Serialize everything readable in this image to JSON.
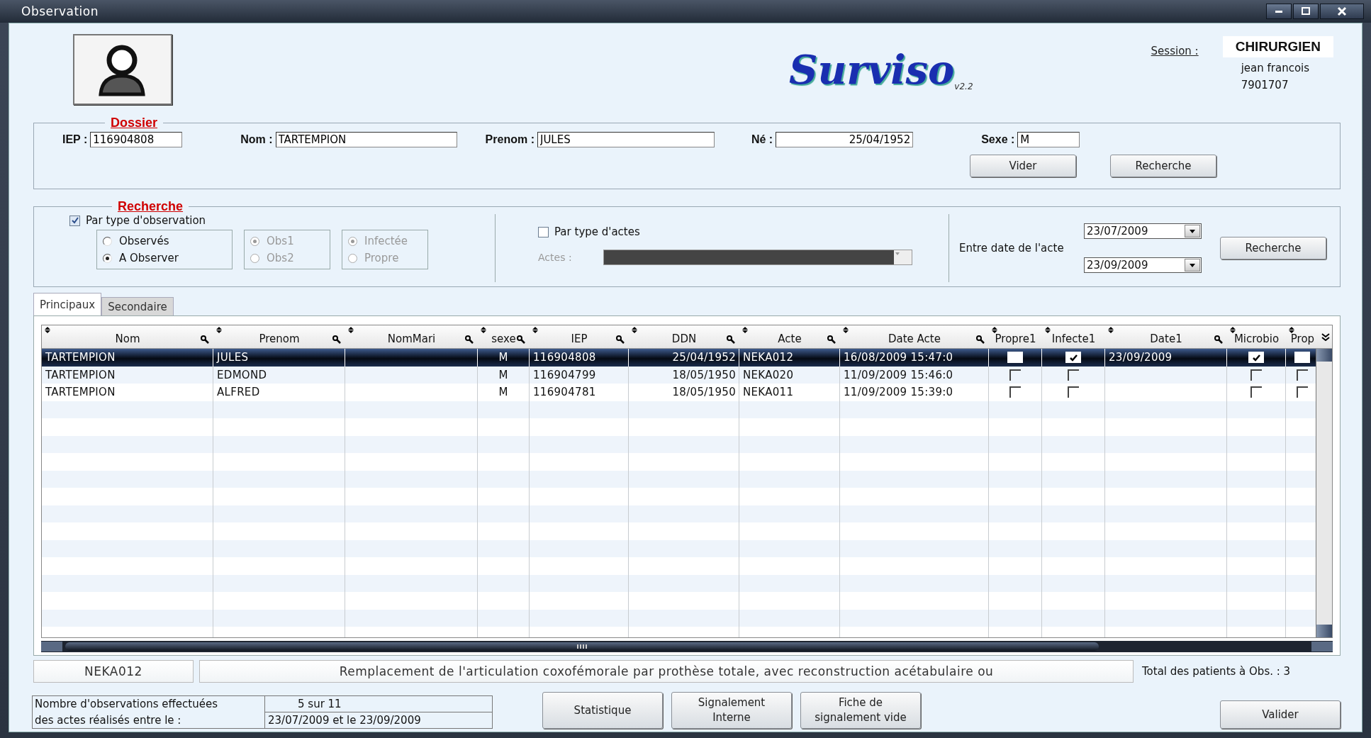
{
  "window": {
    "title": "Observation"
  },
  "header": {
    "logo": "Surviso",
    "version": "v2.2",
    "session_label": "Session :",
    "role": "CHIRURGIEN",
    "user": "jean francois",
    "user_id": "7901707"
  },
  "dossier": {
    "title": "Dossier",
    "fields": [
      {
        "label": "IEP :",
        "value": "116904808"
      },
      {
        "label": "Nom :",
        "value": "TARTEMPION"
      },
      {
        "label": "Prenom :",
        "value": "JULES"
      },
      {
        "label": "Né :",
        "value": "25/04/1952"
      },
      {
        "label": "Sexe :",
        "value": "M"
      }
    ],
    "buttons": [
      "Vider",
      "Recherche"
    ]
  },
  "recherche": {
    "title": "Recherche",
    "observation_filter": {
      "label": "Par type d'observation",
      "checked": true
    },
    "groups": [
      {
        "disabled": false,
        "options": [
          {
            "label": "Observés",
            "selected": false
          },
          {
            "label": "A Observer",
            "selected": true
          }
        ]
      },
      {
        "disabled": true,
        "options": [
          {
            "label": "Obs1",
            "selected": true
          },
          {
            "label": "Obs2",
            "selected": false
          }
        ]
      },
      {
        "disabled": true,
        "options": [
          {
            "label": "Infectée",
            "selected": true
          },
          {
            "label": "Propre",
            "selected": false
          }
        ]
      }
    ],
    "acts_filter": {
      "label": "Par type d'actes",
      "checked": false
    },
    "acts_label": "Actes :",
    "date_from": "23/07/2009",
    "date_label": "Entre date de l'acte",
    "date_to": "23/09/2009",
    "button": "Recherche"
  },
  "tabs": [
    {
      "label": "Principaux",
      "selected": true
    },
    {
      "label": "Secondaire",
      "selected": false
    }
  ],
  "table": {
    "columns": [
      {
        "label": "Nom",
        "kind": "text"
      },
      {
        "label": "Prenom",
        "kind": "text"
      },
      {
        "label": "NomMari",
        "kind": "text"
      },
      {
        "label": "sexe",
        "kind": "text"
      },
      {
        "label": "IEP",
        "kind": "text"
      },
      {
        "label": "DDN",
        "kind": "text"
      },
      {
        "label": "Acte",
        "kind": "text"
      },
      {
        "label": "Date Acte",
        "kind": "text"
      },
      {
        "label": "Propre1",
        "kind": "check"
      },
      {
        "label": "Infecte1",
        "kind": "check"
      },
      {
        "label": "Date1",
        "kind": "text"
      },
      {
        "label": "Microbio",
        "kind": "check"
      },
      {
        "label": "Prop",
        "kind": "check"
      }
    ],
    "rows": [
      {
        "selected": true,
        "cells": [
          "TARTEMPION",
          "JULES",
          null,
          "M",
          "116904808",
          "25/04/1952",
          "NEKA012",
          "16/08/2009 15:47:0",
          {
            "checked": false
          },
          {
            "checked": true
          },
          "23/09/2009",
          {
            "checked": true
          },
          {
            "checked": false
          }
        ]
      },
      {
        "selected": false,
        "cells": [
          "TARTEMPION",
          "EDMOND",
          null,
          "M",
          "116904799",
          "18/05/1950",
          "NEKA020",
          "11/09/2009 15:46:0",
          {
            "checked": false
          },
          {
            "checked": false
          },
          null,
          {
            "checked": false
          },
          {
            "checked": false
          }
        ]
      },
      {
        "selected": false,
        "cells": [
          "TARTEMPION",
          "ALFRED",
          null,
          "M",
          "116904781",
          "18/05/1950",
          "NEKA011",
          "11/09/2009 15:39:0",
          {
            "checked": false
          },
          {
            "checked": false
          },
          null,
          {
            "checked": false
          },
          {
            "checked": false
          }
        ]
      }
    ]
  },
  "status": {
    "code": "NEKA012",
    "description": "Remplacement de l'articulation coxofémorale par prothèse totale, avec reconstruction acétabulaire ou",
    "total": "Total des patients à Obs. : 3"
  },
  "summary": [
    {
      "label": "Nombre d'observations effectuées",
      "value": "5  sur 11"
    },
    {
      "label": "des actes réalisés entre le :",
      "value": "23/07/2009 et le 23/09/2009"
    }
  ],
  "buttons": [
    "Statistique",
    "Signalement Interne",
    "Fiche de signalement vide",
    "Valider"
  ]
}
